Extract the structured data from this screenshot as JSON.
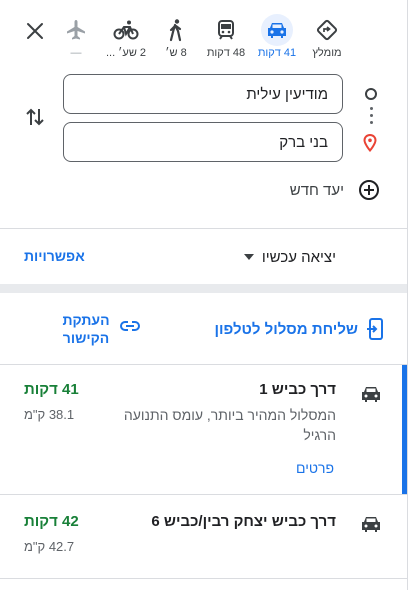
{
  "modes": [
    {
      "name": "best",
      "label": "מומלץ",
      "icon": "diamond-turn-icon"
    },
    {
      "name": "drive",
      "label": "41 דקות",
      "icon": "car-icon",
      "active": true
    },
    {
      "name": "transit",
      "label": "48 דקות",
      "icon": "train-icon"
    },
    {
      "name": "walk",
      "label": "8 ש׳",
      "icon": "walk-icon"
    },
    {
      "name": "bike",
      "label": "2 שע׳ ...",
      "icon": "bike-icon"
    },
    {
      "name": "flight",
      "label": "—",
      "icon": "airplane-icon",
      "disabled": true
    }
  ],
  "origin": {
    "value": "מודיעין עילית"
  },
  "destination": {
    "value": "בני ברק"
  },
  "add_destination_label": "יעד חדש",
  "depart": {
    "label": "יציאה עכשיו"
  },
  "options_label": "אפשרויות",
  "send_to_phone_label": "שליחת מסלול לטלפון",
  "copy_link_label": "העתקת הקישור",
  "routes": [
    {
      "name": "דרך כביש 1",
      "time": "41 דקות",
      "distance": "38.1 ק\"מ",
      "description": "המסלול המהיר ביותר, עומס התנועה הרגיל",
      "details_label": "פרטים"
    },
    {
      "name": "דרך כביש יצחק רבין/כביש 6",
      "time": "42 דקות",
      "distance": "42.7 ק\"מ"
    }
  ],
  "colors": {
    "accent": "#1a73e8",
    "time_green": "#188038",
    "pin_red": "#ea4335"
  }
}
